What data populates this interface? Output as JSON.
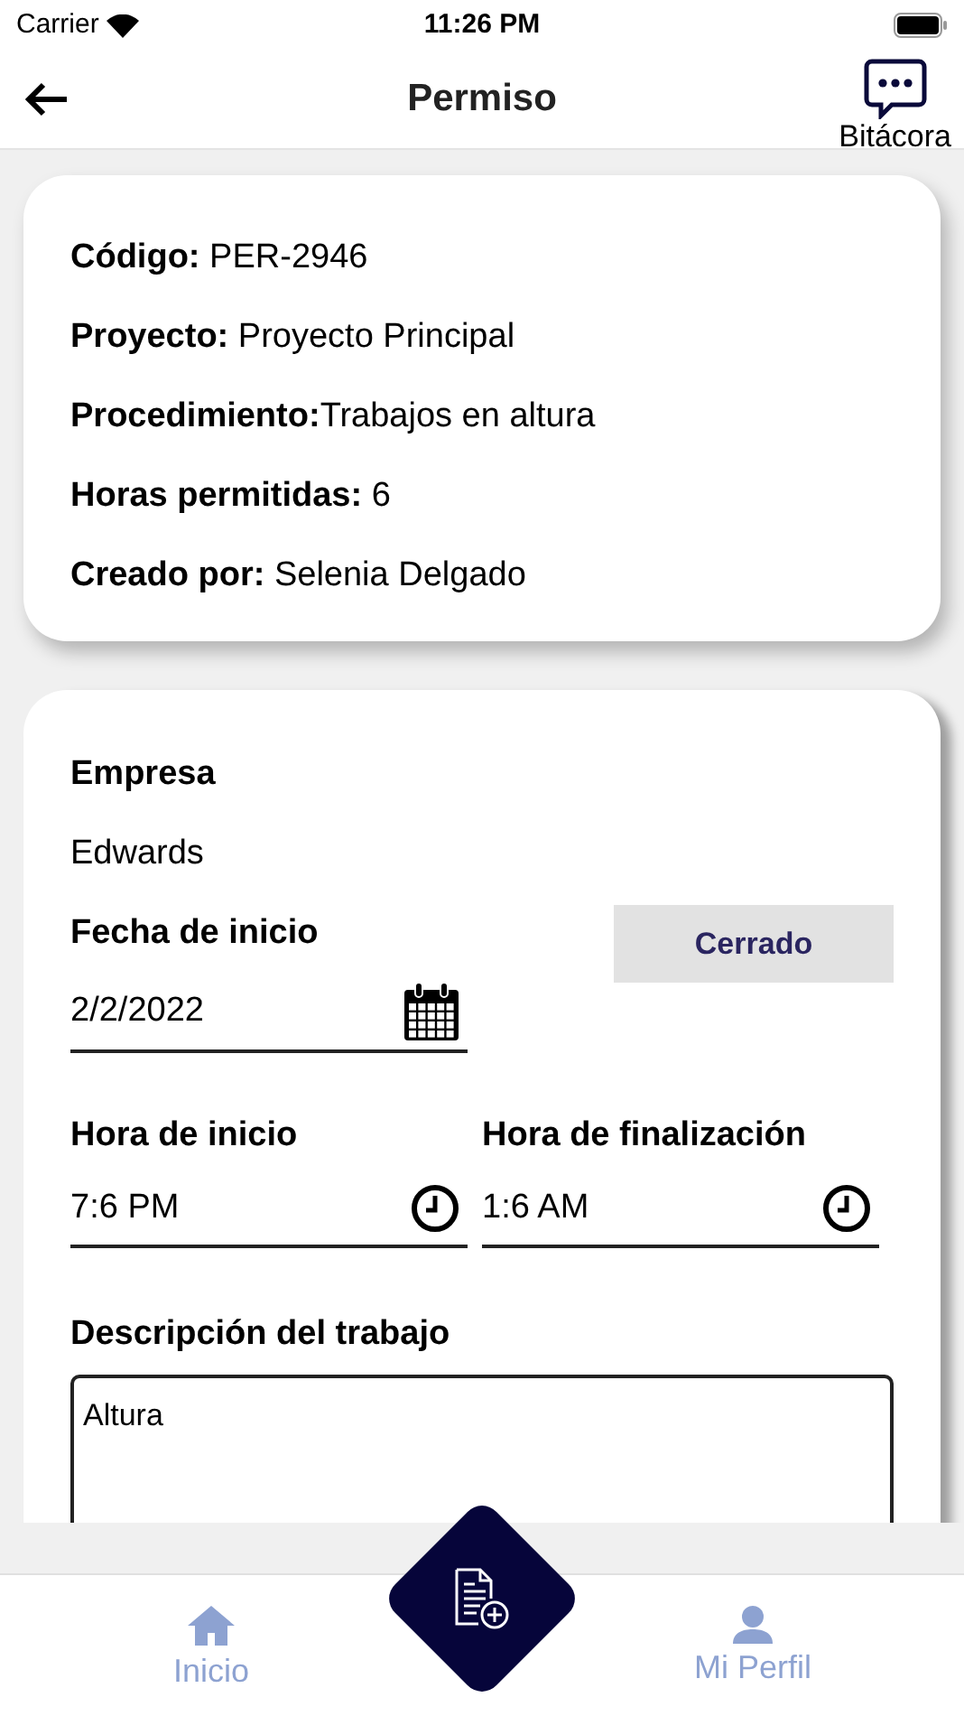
{
  "status_bar": {
    "carrier": "Carrier",
    "time": "11:26 PM"
  },
  "header": {
    "title": "Permiso",
    "log_button": "Bitácora"
  },
  "summary": [
    "**Código:** PER-2946",
    "**Proyecto:** Proyecto Principal",
    "**Procedimiento:**Trabajos en altura",
    "**Horas permitidas:** 6",
    "**Creado por:** Selenia Delgado"
  ],
  "form": {
    "company_label": "Empresa",
    "company": "Edwards",
    "start_date_label": "Fecha de inicio",
    "start_date": "2/2/2022",
    "status_button": "Cerrado",
    "times": [
      {
        "label": "Hora de inicio",
        "value": "7:6 PM"
      },
      {
        "label": "Hora de finalización",
        "value": "1:6 AM"
      }
    ],
    "description_label": "Descripción del trabajo",
    "description": "Altura"
  },
  "tab_bar": [
    {
      "label": "Inicio",
      "kind": "home"
    },
    {
      "label": "Mi Perfil",
      "kind": "profile"
    }
  ]
}
